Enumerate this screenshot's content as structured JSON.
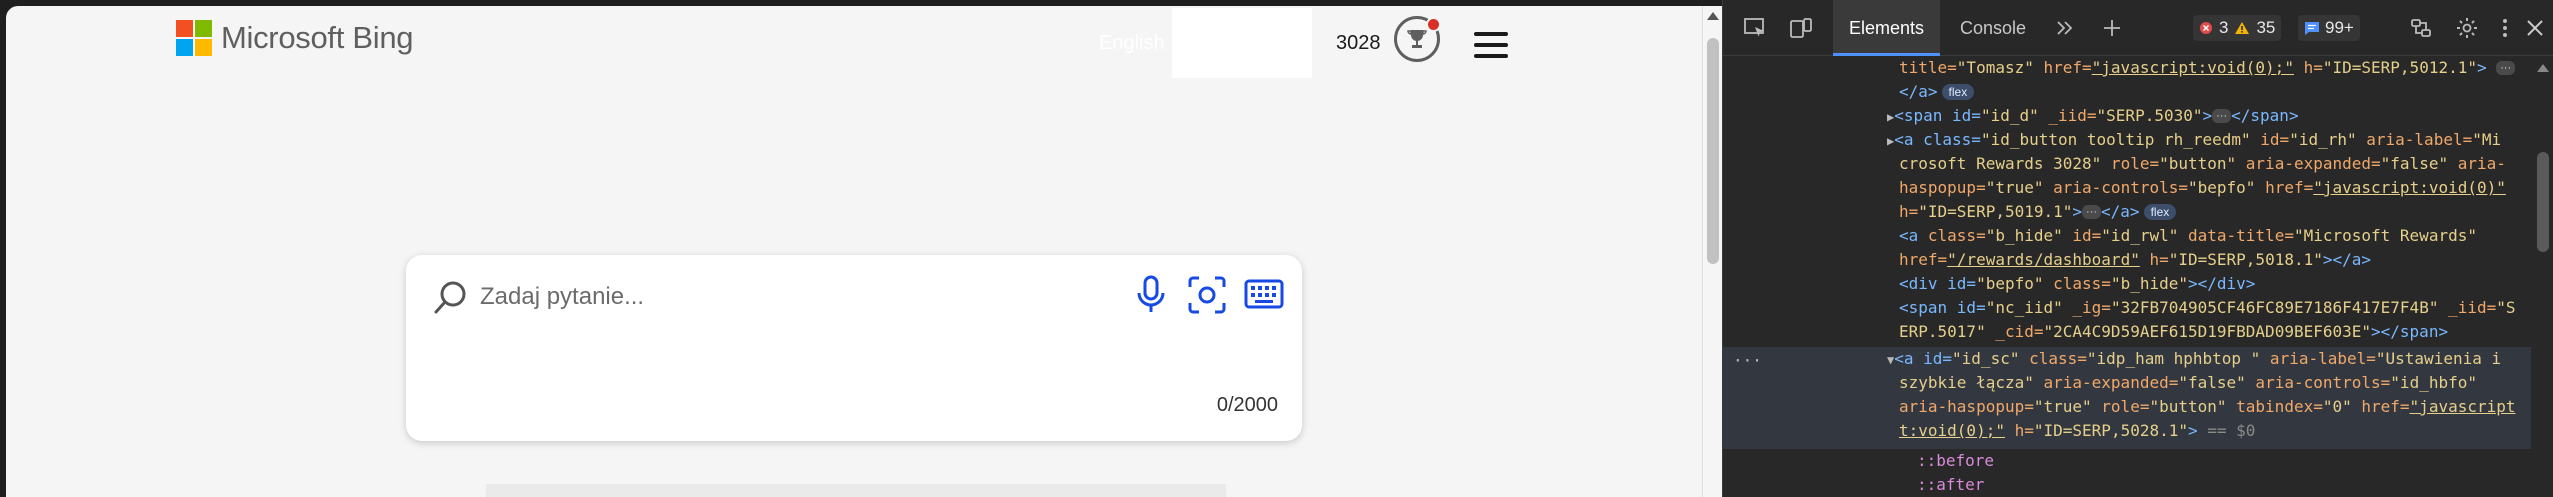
{
  "bing": {
    "logo_text": "Microsoft Bing",
    "logo_colors": [
      "#f25022",
      "#7fba00",
      "#00a4ef",
      "#ffb900"
    ],
    "language_link": "English",
    "rewards_points": "3028",
    "search": {
      "placeholder": "Zadaj pytanie...",
      "char_count": "0/2000"
    }
  },
  "devtools": {
    "tabs": [
      "Elements",
      "Console"
    ],
    "active_tab": "Elements",
    "errors": "3",
    "warnings": "35",
    "messages": "99+",
    "accent_color": "#4d90fe",
    "lines": {
      "l1_a": "title=",
      "l1_b": "\"Tomasz\"",
      "l1_c": " href=",
      "l1_d": "\"javascript:void(0);\"",
      "l1_e": " h=",
      "l1_f": "\"ID=SERP,5012.1\"",
      "l1_g": ">",
      "l2_a": "</a>",
      "pill_flex": "flex",
      "l3_a": "<span id=",
      "l3_b": "\"id_d\"",
      "l3_c": " _iid=",
      "l3_d": "\"SERP.5030\"",
      "l3_e": ">",
      "l3_f": "</span>",
      "l4_a": "<a class=",
      "l4_b": "\"id_button tooltip rh_reedm\"",
      "l4_c": " id=",
      "l4_d": "\"id_rh\"",
      "l4_e": " aria-label=",
      "l4_f": "\"Mi",
      "l5_a": "crosoft Rewards 3028\"",
      "l5_b": " role=",
      "l5_c": "\"button\"",
      "l5_d": " aria-expanded=",
      "l5_e": "\"false\"",
      "l5_f": " aria-",
      "l6_a": "haspopup=",
      "l6_b": "\"true\"",
      "l6_c": " aria-controls=",
      "l6_d": "\"bepfo\"",
      "l6_e": " href=",
      "l6_f": "\"javascript:void(0)\"",
      "l7_a": "h=",
      "l7_b": "\"ID=SERP,5019.1\"",
      "l7_c": ">",
      "l7_d": "</a>",
      "l8_a": "<a",
      "l8_b": " class=",
      "l8_c": "\"b_hide\"",
      "l8_d": " id=",
      "l8_e": "\"id_rwl\"",
      "l8_f": " data-title=",
      "l8_g": "\"Microsoft Rewards\"",
      "l9_a": "href=",
      "l9_b": "\"/rewards/dashboard\"",
      "l9_c": " h=",
      "l9_d": "\"ID=SERP,5018.1\"",
      "l9_e": "></a>",
      "l10_a": "<div id=",
      "l10_b": "\"bepfo\"",
      "l10_c": " class=",
      "l10_d": "\"b_hide\"",
      "l10_e": "></div>",
      "l11_a": "<span id=",
      "l11_b": "\"nc_iid\"",
      "l11_c": " _ig=",
      "l11_d": "\"32FB704905CF46FC89E7186F417E7F4B\"",
      "l11_e": " _iid=",
      "l11_f": "\"S",
      "l12_a": "ERP.5017\"",
      "l12_b": " _cid=",
      "l12_c": "\"2CA4C9D59AEF615D19FBDAD09BEF603E\"",
      "l12_d": "></span>",
      "l13_a": "<a id=",
      "l13_b": "\"id_sc\"",
      "l13_c": " class=",
      "l13_d": "\"idp_ham hphbtop \"",
      "l13_e": " aria-label=",
      "l13_f": "\"Ustawienia i",
      "l14_a": "szybkie łącza\"",
      "l14_b": " aria-expanded=",
      "l14_c": "\"false\"",
      "l14_d": " aria-controls=",
      "l14_e": "\"id_hbfo\"",
      "l15_a": "aria-haspopup=",
      "l15_b": "\"true\"",
      "l15_c": " role=",
      "l15_d": "\"button\"",
      "l15_e": " tabindex=",
      "l15_f": "\"0\"",
      "l15_g": " href=",
      "l15_h": "\"javascript",
      "l16_a": "t:void(0);\"",
      "l16_b": " h=",
      "l16_c": "\"ID=SERP,5028.1\"",
      "l16_d": ">",
      "l16_e": " == $0",
      "l17_a": "::before",
      "l18_a": "::after"
    }
  }
}
